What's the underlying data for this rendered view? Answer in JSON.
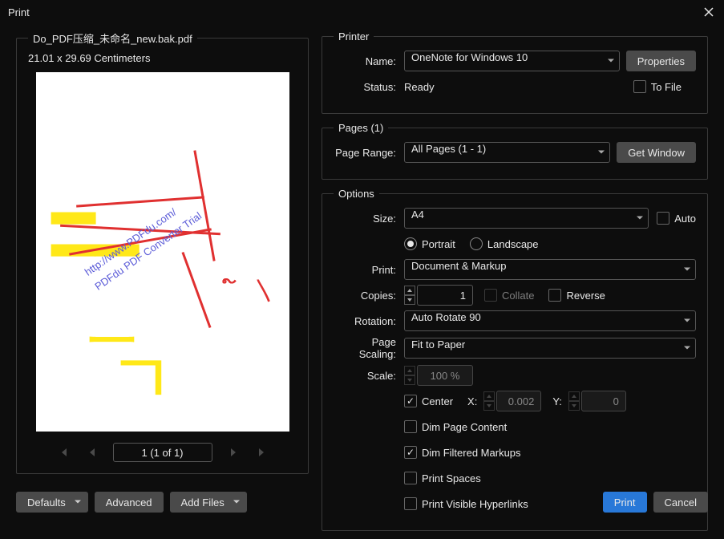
{
  "window": {
    "title": "Print"
  },
  "preview": {
    "filename": "Do_PDF压缩_未命名_new.bak.pdf",
    "dimensions": "21.01  x  29.69 Centimeters",
    "page_indicator": "1 (1 of 1)",
    "watermark_line1": "http://www.PDFdu.com/",
    "watermark_line2": "PDFdu PDF Converter Trial"
  },
  "printer": {
    "group_label": "Printer",
    "name_label": "Name:",
    "name_value": "OneNote for Windows 10",
    "properties_btn": "Properties",
    "status_label": "Status:",
    "status_value": "Ready",
    "to_file": "To File",
    "to_file_checked": false
  },
  "pages": {
    "group_label": "Pages (1)",
    "range_label": "Page Range:",
    "range_value": "All Pages (1 - 1)",
    "get_window_btn": "Get Window"
  },
  "options": {
    "group_label": "Options",
    "size_label": "Size:",
    "size_value": "A4",
    "auto_label": "Auto",
    "auto_checked": false,
    "portrait": "Portrait",
    "landscape": "Landscape",
    "orientation": "portrait",
    "print_label": "Print:",
    "print_value": "Document & Markup",
    "copies_label": "Copies:",
    "copies_value": "1",
    "collate": "Collate",
    "collate_checked": false,
    "reverse": "Reverse",
    "reverse_checked": false,
    "rotation_label": "Rotation:",
    "rotation_value": "Auto Rotate 90",
    "scaling_label": "Page Scaling:",
    "scaling_value": "Fit to Paper",
    "scale_label": "Scale:",
    "scale_value": "100 %",
    "center": "Center",
    "center_checked": true,
    "x_label": "X:",
    "x_value": "0.002",
    "y_label": "Y:",
    "y_value": "0",
    "dim_page": "Dim Page Content",
    "dim_page_checked": false,
    "dim_filtered": "Dim Filtered Markups",
    "dim_filtered_checked": true,
    "print_spaces": "Print Spaces",
    "print_spaces_checked": false,
    "print_hyperlinks": "Print Visible Hyperlinks",
    "print_hyperlinks_checked": false
  },
  "footer": {
    "defaults": "Defaults",
    "advanced": "Advanced",
    "add_files": "Add Files",
    "print": "Print",
    "cancel": "Cancel"
  }
}
